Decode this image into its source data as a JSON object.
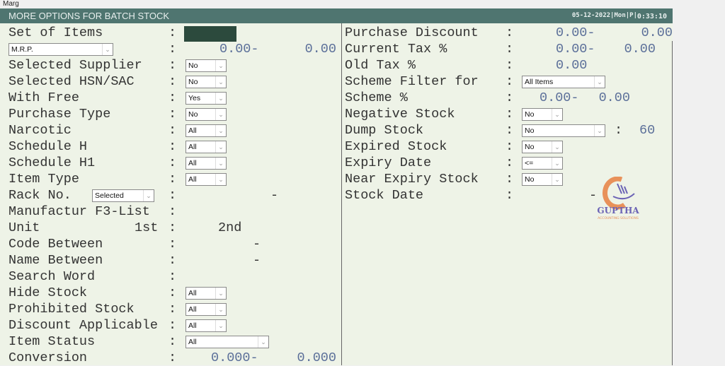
{
  "app_title": "Marg",
  "window": {
    "title": "MORE OPTIONS FOR BATCH STOCK",
    "date_info": "05-12-2022|Mon|P|",
    "clock": "0:33:10"
  },
  "left": [
    {
      "label": "Set of Items",
      "type": "darkbox"
    },
    {
      "select": "M.R.P.",
      "from": "0.00-",
      "to": "0.00"
    },
    {
      "label": "Selected Supplier",
      "value": "No"
    },
    {
      "label": "Selected HSN/SAC",
      "value": "No"
    },
    {
      "label": "With Free",
      "value": "Yes"
    },
    {
      "label": "Purchase Type",
      "value": "No"
    },
    {
      "label": "Narcotic",
      "value": "All"
    },
    {
      "label": "Schedule H",
      "value": "All"
    },
    {
      "label": "Schedule H1",
      "value": "All"
    },
    {
      "label": "Item Type",
      "value": "All"
    },
    {
      "label": "Rack No.",
      "select": "Selected",
      "dash": "-"
    },
    {
      "label": "Manufactur F3-List"
    },
    {
      "label": "Unit",
      "sub": "1st",
      "second": "2nd"
    },
    {
      "label": "Code Between",
      "dash": "-"
    },
    {
      "label": "Name Between",
      "dash": "-"
    },
    {
      "label": "Search Word"
    },
    {
      "label": "Hide Stock",
      "value": "All"
    },
    {
      "label": "Prohibited Stock",
      "value": "All"
    },
    {
      "label": "Discount Applicable",
      "value": "All"
    },
    {
      "label": "Item Status",
      "value": "All",
      "wide": true
    },
    {
      "label": "Conversion",
      "from": "0.000-",
      "to": "0.000"
    }
  ],
  "right": [
    {
      "label": "Purchase Discount",
      "from": "0.00-",
      "to": "0.00"
    },
    {
      "label": "Current Tax %",
      "from": "0.00-",
      "to": "0.00"
    },
    {
      "label": "Old Tax %",
      "from": "0.00"
    },
    {
      "label": "Scheme Filter for",
      "value": "All Items"
    },
    {
      "label": "Scheme %",
      "from": "0.00-",
      "to": "0.00"
    },
    {
      "label": "Negative Stock",
      "value": "No"
    },
    {
      "label": "Dump Stock",
      "value": "No",
      "days": "60"
    },
    {
      "label": "Expired Stock",
      "value": "No"
    },
    {
      "label": "Expiry Date",
      "value": "<="
    },
    {
      "label": "Near Expiry Stock",
      "value": "No"
    },
    {
      "label": "Stock Date",
      "dash": "-"
    }
  ],
  "logo": {
    "name": "GUPTHA",
    "tagline": "ACCOUNTING SOLUTIONS",
    "colors": {
      "g": "#e8915a",
      "text": "#6b63b5",
      "tag": "#e8915a"
    }
  }
}
